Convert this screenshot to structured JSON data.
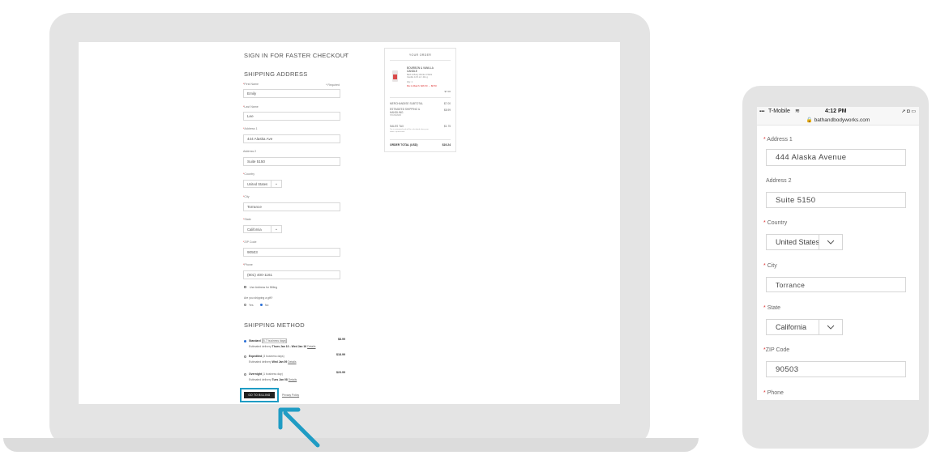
{
  "laptop": {
    "signin_heading": "SIGN IN FOR FASTER CHECKOUT",
    "signin_chevron": "chevron-down-icon",
    "shipping_heading": "SHIPPING ADDRESS",
    "required_note": "* Required",
    "fields": {
      "first_name": {
        "label": "First Name",
        "value": "Emily"
      },
      "last_name": {
        "label": "Last Name",
        "value": "Lee"
      },
      "address1": {
        "label": "Address 1",
        "value": "444 Alaska Ave"
      },
      "address2": {
        "label": "Address 2",
        "value": "Suite 5150"
      },
      "country": {
        "label": "Country",
        "value": "United States"
      },
      "city": {
        "label": "City",
        "value": "Torrance"
      },
      "state": {
        "label": "State",
        "value": "California"
      },
      "zip": {
        "label": "ZIP Code",
        "value": "90503"
      },
      "phone": {
        "label": "Phone",
        "value": "(801) 400-1161"
      }
    },
    "billing_checkbox_label": "Use Address for Billing",
    "gift_question": "Are you shipping a gift?",
    "gift_yes": "Yes",
    "gift_no": "No",
    "method_heading": "SHIPPING METHOD",
    "methods": [
      {
        "name": "Standard",
        "days": "(5-7 business days)",
        "delivery_prefix": "Estimated delivery",
        "delivery": "Thurs Jan 10 - Wed Jan 16",
        "details": "Details",
        "price": "$8.99",
        "selected": true
      },
      {
        "name": "Expedited",
        "days": "(3 business days)",
        "delivery_prefix": "Estimated delivery",
        "delivery": "Wed Jan 09",
        "details": "Details",
        "price": "$18.99",
        "selected": false
      },
      {
        "name": "Overnight",
        "days": "(1 business day)",
        "delivery_prefix": "Estimated delivery",
        "delivery": "Tues Jan 08",
        "details": "Details",
        "price": "$23.99",
        "selected": false
      }
    ],
    "go_to_billing": "GO TO BILLING",
    "privacy_policy": "Privacy Policy",
    "order": {
      "title": "YOUR ORDER",
      "item_name": "BOURBON & VANILLA\nCANDLE",
      "item_desc": "Bath & Body Works 3-Wick Candle 14.5 oz / 411 g",
      "item_qty": "Qty: 1",
      "item_promo": "Mix & Match: $26.50 → $8.50",
      "item_price": "$7.00",
      "subtotal_label": "MERCHANDISE SUBTOTAL",
      "subtotal_value": "$7.00",
      "shipping_label": "ESTIMATED SHIPPING &\nHANDLING",
      "shipping_sub": "STANDARD",
      "shipping_value": "$8.99",
      "tax_label": "SALES TAX",
      "tax_note": "Tax is estimated and will be calculated when your order is processed.",
      "tax_value": "$1.75",
      "total_label": "ORDER TOTAL (USD)",
      "total_value": "$19.24"
    }
  },
  "phone": {
    "carrier": "T-Mobile",
    "time": "4:12 PM",
    "url": "bathandbodyworks.com",
    "lock_icon": "lock-icon",
    "fields": {
      "address1": {
        "label": "Address 1",
        "value": "444 Alaska Avenue"
      },
      "address2": {
        "label": "Address 2",
        "value": "Suite 5150"
      },
      "country": {
        "label": "Country",
        "value": "United States"
      },
      "city": {
        "label": "City",
        "value": "Torrance"
      },
      "state": {
        "label": "State",
        "value": "California"
      },
      "zip": {
        "label": "ZIP Code",
        "value": "90503"
      },
      "phone": {
        "label": "Phone"
      }
    }
  },
  "colors": {
    "highlight": "#1f9cc4",
    "required": "#dd3333",
    "radio_selected": "#2a6fd6"
  }
}
